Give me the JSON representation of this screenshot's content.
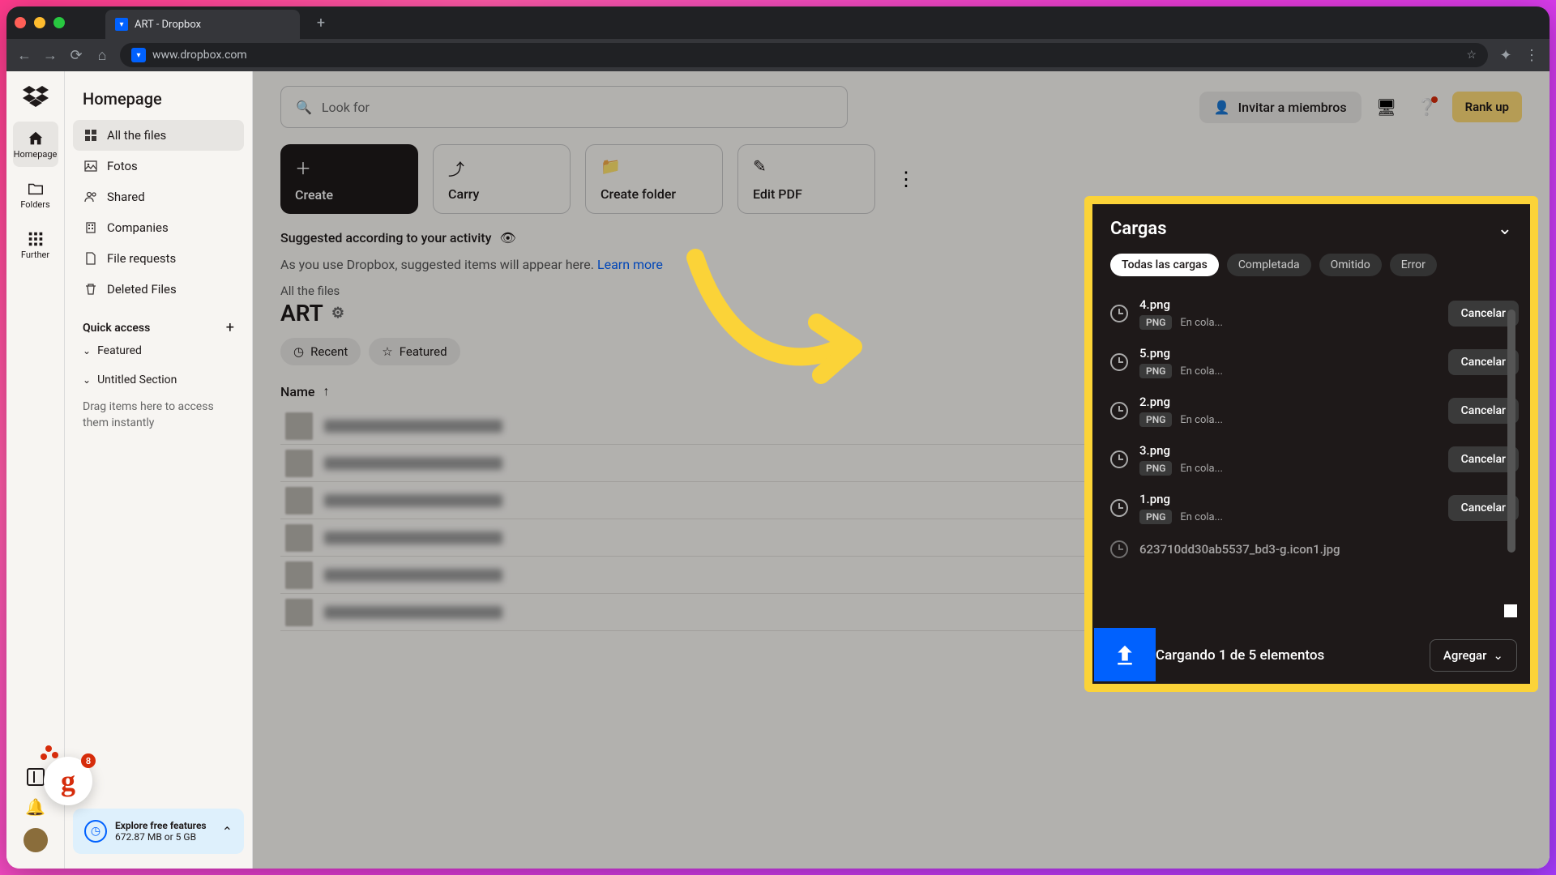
{
  "browser": {
    "tab_title": "ART - Dropbox",
    "url": "www.dropbox.com"
  },
  "rail": {
    "home": "Homepage",
    "folders": "Folders",
    "further": "Further",
    "notification_count": "8"
  },
  "sidebar": {
    "breadcrumb": "Homepage",
    "items": {
      "all_files": "All the files",
      "photos": "Fotos",
      "shared": "Shared",
      "companies": "Companies",
      "file_requests": "File requests",
      "deleted": "Deleted Files"
    },
    "quick_access": "Quick access",
    "featured": "Featured",
    "untitled": "Untitled Section",
    "drag_hint": "Drag items here to access them instantly",
    "promo_title": "Explore free features",
    "promo_sub": "672.87 MB or 5 GB"
  },
  "main": {
    "search_placeholder": "Look for",
    "invite": "Invitar a miembros",
    "rank_up": "Rank up",
    "actions": {
      "create": "Create",
      "carry": "Carry",
      "create_folder": "Create folder",
      "edit_pdf": "Edit PDF"
    },
    "suggested_label": "Suggested according to your activity",
    "hint_text": "As you use Dropbox, suggested items will appear here. ",
    "learn_more": "Learn more",
    "crumb": "All the files",
    "folder_name": "ART",
    "recent": "Recent",
    "featured": "Featured",
    "name_col": "Name"
  },
  "uploads": {
    "title": "Cargas",
    "tabs": {
      "all": "Todas las cargas",
      "completed": "Completada",
      "skipped": "Omitido",
      "error": "Error"
    },
    "items": [
      {
        "name": "4.png",
        "badge": "PNG",
        "status": "En cola...",
        "cancel": "Cancelar"
      },
      {
        "name": "5.png",
        "badge": "PNG",
        "status": "En cola...",
        "cancel": "Cancelar"
      },
      {
        "name": "2.png",
        "badge": "PNG",
        "status": "En cola...",
        "cancel": "Cancelar"
      },
      {
        "name": "3.png",
        "badge": "PNG",
        "status": "En cola...",
        "cancel": "Cancelar"
      },
      {
        "name": "1.png",
        "badge": "PNG",
        "status": "En cola...",
        "cancel": "Cancelar"
      },
      {
        "name": "623710dd30ab5537_bd3-g.icon1.jpg",
        "badge": "",
        "status": "",
        "cancel": ""
      }
    ],
    "footer_text": "Cargando 1 de 5 elementos",
    "add": "Agregar"
  }
}
